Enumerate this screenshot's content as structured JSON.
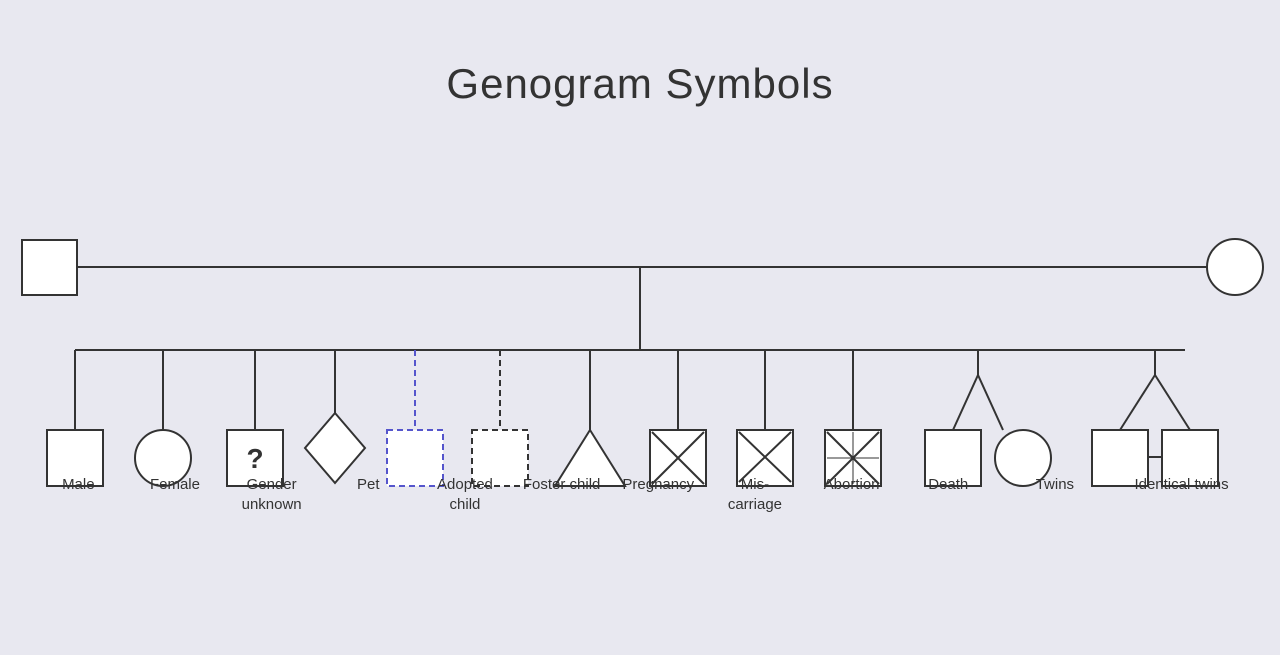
{
  "page": {
    "title": "Genogram Symbols",
    "background_color": "#e8e8f0"
  },
  "symbols": [
    {
      "id": "male",
      "label": "Male"
    },
    {
      "id": "female",
      "label": "Female"
    },
    {
      "id": "gender-unknown",
      "label": "Gender unknown"
    },
    {
      "id": "pet",
      "label": "Pet"
    },
    {
      "id": "adopted-child",
      "label": "Adopted child"
    },
    {
      "id": "foster-child",
      "label": "Foster child"
    },
    {
      "id": "pregnancy",
      "label": "Pregnancy"
    },
    {
      "id": "miscarriage",
      "label": "Mis-carriage"
    },
    {
      "id": "abortion",
      "label": "Abortion"
    },
    {
      "id": "death",
      "label": "Death"
    },
    {
      "id": "twins",
      "label": "Twins"
    },
    {
      "id": "identical-twins",
      "label": "Identical twins"
    }
  ]
}
